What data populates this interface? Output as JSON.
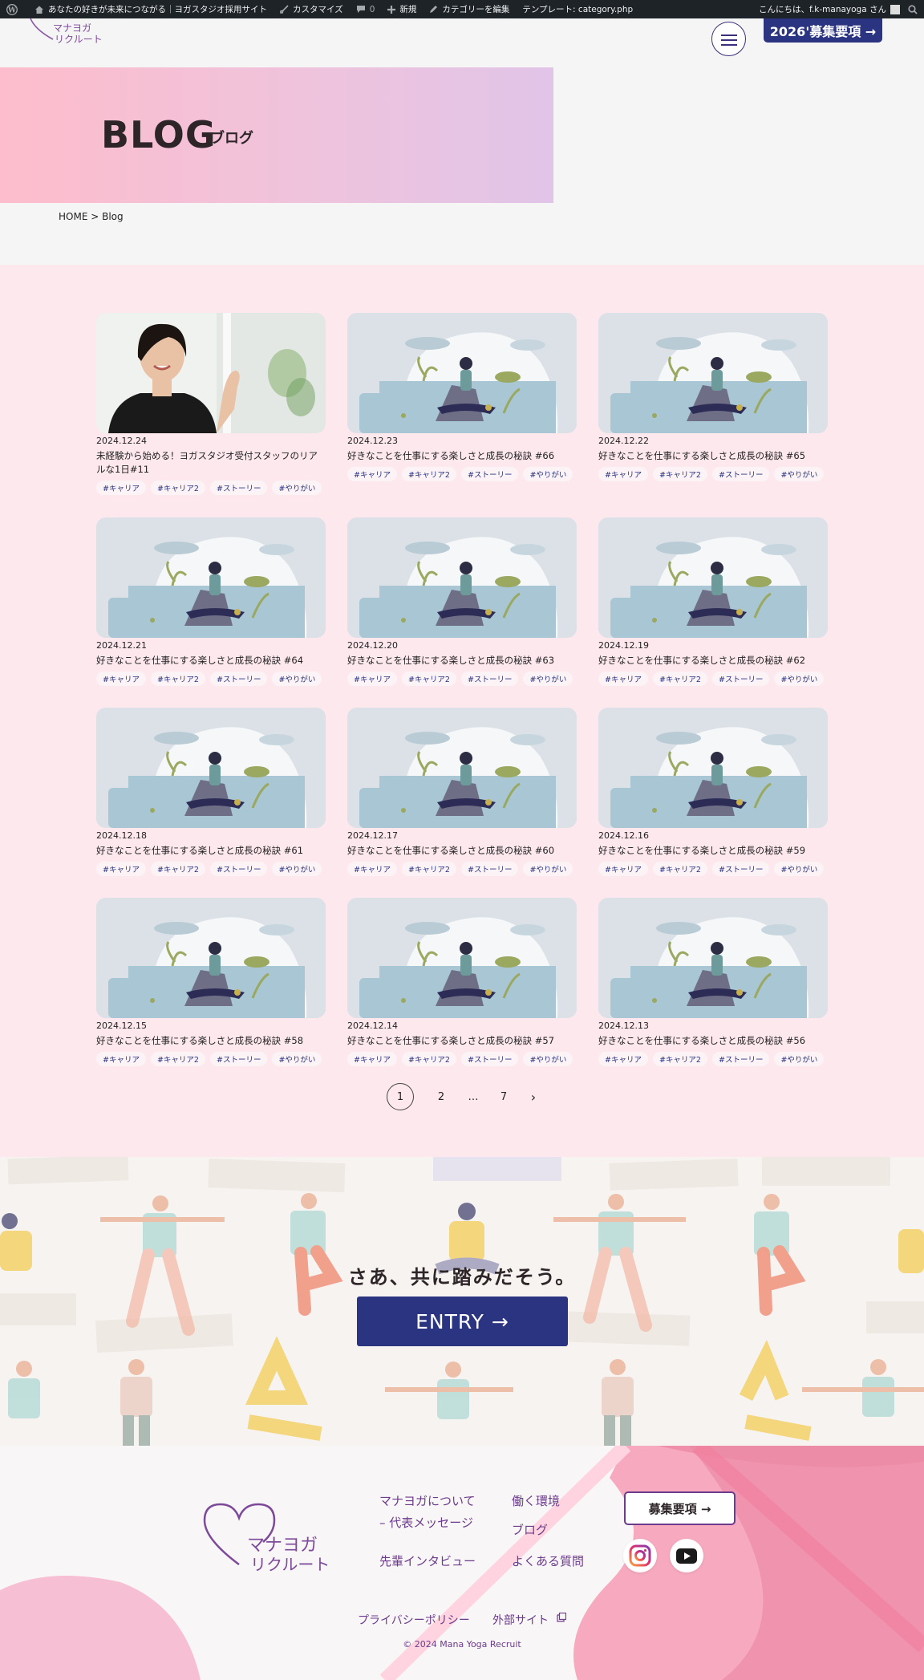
{
  "admin_bar": {
    "site_name": "あなたの好きが未来につながる｜ヨガスタジオ採用サイト",
    "customize": "カスタマイズ",
    "comments": "0",
    "new": "新規",
    "edit_category": "カテゴリーを編集",
    "template": "テンプレート: category.php",
    "greeting": "こんにちは、f.k-manayoga さん"
  },
  "header": {
    "logo_line1": "マナヨガ",
    "logo_line2": "リクルート",
    "recruit_button": "2026'募集要項 →"
  },
  "hero": {
    "title_en": "BLOG",
    "title_jp": "ブログ"
  },
  "breadcrumb": "HOME > Blog",
  "posts": [
    {
      "date": "2024.12.24",
      "title": "未経験から始める！ヨガスタジオ受付スタッフのリアルな1日#11",
      "image": "staff-photo",
      "tags": [
        "#キャリア",
        "#キャリア2",
        "#ストーリー",
        "#やりがい"
      ]
    },
    {
      "date": "2024.12.23",
      "title": "好きなことを仕事にする楽しさと成長の秘訣 #66",
      "image": "yoga-illustration",
      "tags": [
        "#キャリア",
        "#キャリア2",
        "#ストーリー",
        "#やりがい"
      ]
    },
    {
      "date": "2024.12.22",
      "title": "好きなことを仕事にする楽しさと成長の秘訣 #65",
      "image": "yoga-illustration",
      "tags": [
        "#キャリア",
        "#キャリア2",
        "#ストーリー",
        "#やりがい"
      ]
    },
    {
      "date": "2024.12.21",
      "title": "好きなことを仕事にする楽しさと成長の秘訣 #64",
      "image": "yoga-illustration",
      "tags": [
        "#キャリア",
        "#キャリア2",
        "#ストーリー",
        "#やりがい"
      ]
    },
    {
      "date": "2024.12.20",
      "title": "好きなことを仕事にする楽しさと成長の秘訣 #63",
      "image": "yoga-illustration",
      "tags": [
        "#キャリア",
        "#キャリア2",
        "#ストーリー",
        "#やりがい"
      ]
    },
    {
      "date": "2024.12.19",
      "title": "好きなことを仕事にする楽しさと成長の秘訣 #62",
      "image": "yoga-illustration",
      "tags": [
        "#キャリア",
        "#キャリア2",
        "#ストーリー",
        "#やりがい"
      ]
    },
    {
      "date": "2024.12.18",
      "title": "好きなことを仕事にする楽しさと成長の秘訣 #61",
      "image": "yoga-illustration",
      "tags": [
        "#キャリア",
        "#キャリア2",
        "#ストーリー",
        "#やりがい"
      ]
    },
    {
      "date": "2024.12.17",
      "title": "好きなことを仕事にする楽しさと成長の秘訣 #60",
      "image": "yoga-illustration",
      "tags": [
        "#キャリア",
        "#キャリア2",
        "#ストーリー",
        "#やりがい"
      ]
    },
    {
      "date": "2024.12.16",
      "title": "好きなことを仕事にする楽しさと成長の秘訣 #59",
      "image": "yoga-illustration",
      "tags": [
        "#キャリア",
        "#キャリア2",
        "#ストーリー",
        "#やりがい"
      ]
    },
    {
      "date": "2024.12.15",
      "title": "好きなことを仕事にする楽しさと成長の秘訣 #58",
      "image": "yoga-illustration",
      "tags": [
        "#キャリア",
        "#キャリア2",
        "#ストーリー",
        "#やりがい"
      ]
    },
    {
      "date": "2024.12.14",
      "title": "好きなことを仕事にする楽しさと成長の秘訣 #57",
      "image": "yoga-illustration",
      "tags": [
        "#キャリア",
        "#キャリア2",
        "#ストーリー",
        "#やりがい"
      ]
    },
    {
      "date": "2024.12.13",
      "title": "好きなことを仕事にする楽しさと成長の秘訣 #56",
      "image": "yoga-illustration",
      "tags": [
        "#キャリア",
        "#キャリア2",
        "#ストーリー",
        "#やりがい"
      ]
    }
  ],
  "pagination": {
    "current": "1",
    "next": "2",
    "ellipsis": "…",
    "last": "7",
    "next_arrow": "›"
  },
  "entry": {
    "lead": "さあ、共に踏みだそう。",
    "button": "ENTRY →"
  },
  "footer": {
    "logo_line1": "マナヨガ",
    "logo_line2": "リクルート",
    "links": {
      "about": "マナヨガについて",
      "message": "– 代表メッセージ",
      "environment": "働く環境",
      "blog": "ブログ",
      "interview": "先輩インタビュー",
      "faq": "よくある質問"
    },
    "recruit_button": "募集要項 →",
    "privacy": "プライバシーポリシー",
    "external": "外部サイト",
    "copyright": "© 2024 Mana Yoga Recruit"
  },
  "colors": {
    "navy": "#2a3480",
    "purple": "#6c3b8c",
    "pink_bg": "#fde8ee",
    "hero_from": "#fdbdcc",
    "hero_to": "#e1c4e8"
  }
}
